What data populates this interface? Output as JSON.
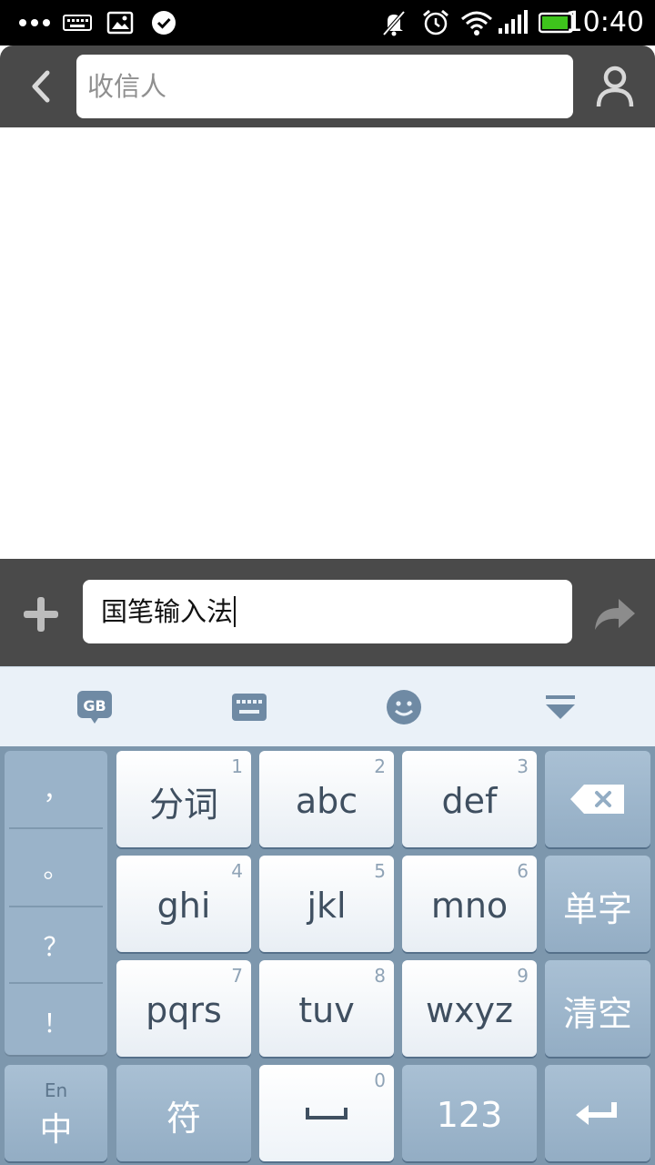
{
  "status_bar": {
    "time": "10:40",
    "icons": [
      "more-dots-icon",
      "keyboard-icon",
      "image-icon",
      "check-circle-icon",
      "mute-icon",
      "alarm-icon",
      "wifi-icon",
      "signal-icon",
      "battery-icon"
    ],
    "battery_level": 0.9
  },
  "header": {
    "recipient_placeholder": "收信人",
    "icons": [
      "back-icon",
      "contact-icon"
    ]
  },
  "compose": {
    "message_text": "国笔输入法",
    "icons": [
      "plus-icon",
      "send-icon"
    ]
  },
  "keyboard_toolbar": {
    "icons": [
      "gb-logo-icon",
      "keyboard-layout-icon",
      "emoji-icon",
      "hide-keyboard-icon"
    ]
  },
  "keyboard": {
    "punctuation": [
      "，",
      "。",
      "？",
      "！"
    ],
    "keys": [
      {
        "label": "分词",
        "num": "1"
      },
      {
        "label": "abc",
        "num": "2"
      },
      {
        "label": "def",
        "num": "3"
      },
      {
        "label": "ghi",
        "num": "4"
      },
      {
        "label": "jkl",
        "num": "5"
      },
      {
        "label": "mno",
        "num": "6"
      },
      {
        "label": "pqrs",
        "num": "7"
      },
      {
        "label": "tuv",
        "num": "8"
      },
      {
        "label": "wxyz",
        "num": "9"
      }
    ],
    "single_char": "单字",
    "clear": "清空",
    "lang_small": "En",
    "lang_main": "中",
    "symbols": "符",
    "space_num": "0",
    "numbers": "123"
  },
  "colors": {
    "header_bg": "#494949",
    "keyboard_bg": "#7d97ad",
    "key_text": "#3f4f60",
    "battery_fill": "#3ec41c"
  }
}
